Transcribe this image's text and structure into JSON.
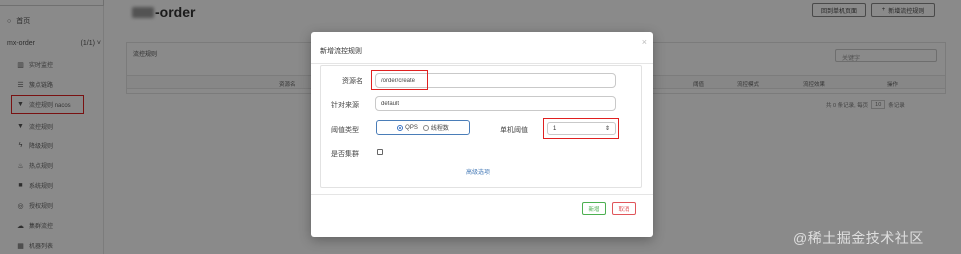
{
  "sidebar": {
    "home_label": "首页",
    "app_name": "mx-order",
    "app_count": "(1/1)",
    "items": [
      {
        "label": "实时监控",
        "icon": "bar-chart-icon"
      },
      {
        "label": "簇点链路",
        "icon": "list-icon"
      },
      {
        "label": "流控规则 nacos",
        "icon": "filter-icon"
      },
      {
        "label": "流控规则",
        "icon": "filter-icon"
      },
      {
        "label": "降级规则",
        "icon": "bolt-icon"
      },
      {
        "label": "热点规则",
        "icon": "fire-icon"
      },
      {
        "label": "系统规则",
        "icon": "lock-icon"
      },
      {
        "label": "授权规则",
        "icon": "shield-icon"
      },
      {
        "label": "集群流控",
        "icon": "cloud-icon"
      },
      {
        "label": "机器列表",
        "icon": "grid-icon"
      }
    ]
  },
  "header": {
    "title": "-order",
    "back_button": "回到单机页面",
    "new_button": "新增流控规则"
  },
  "panel": {
    "title": "流控规则",
    "search_placeholder": "关键字",
    "columns": [
      "资源名",
      "阈值",
      "流控模式",
      "流控效果",
      "操作"
    ],
    "pagination": {
      "prefix": "共 0 条记录, 每页",
      "page_size": "10",
      "suffix": "条记录"
    }
  },
  "modal": {
    "title": "新增流控规则",
    "resource_label": "资源名",
    "resource_value": "/order/create",
    "source_label": "针对来源",
    "source_value": "default",
    "threshold_type_label": "阈值类型",
    "threshold_type_options": [
      "QPS",
      "线程数"
    ],
    "threshold_type_selected": "QPS",
    "single_threshold_label": "单机阈值",
    "single_threshold_value": "1",
    "cluster_label": "是否集群",
    "cluster_checked": false,
    "advanced_link": "高级选项",
    "ok_button": "新增",
    "cancel_button": "取消"
  },
  "watermark": "@稀土掘金技术社区",
  "colors": {
    "highlight": "#e02020",
    "link": "#4a7db8",
    "ok": "#4caf50",
    "cancel": "#e0555a"
  }
}
